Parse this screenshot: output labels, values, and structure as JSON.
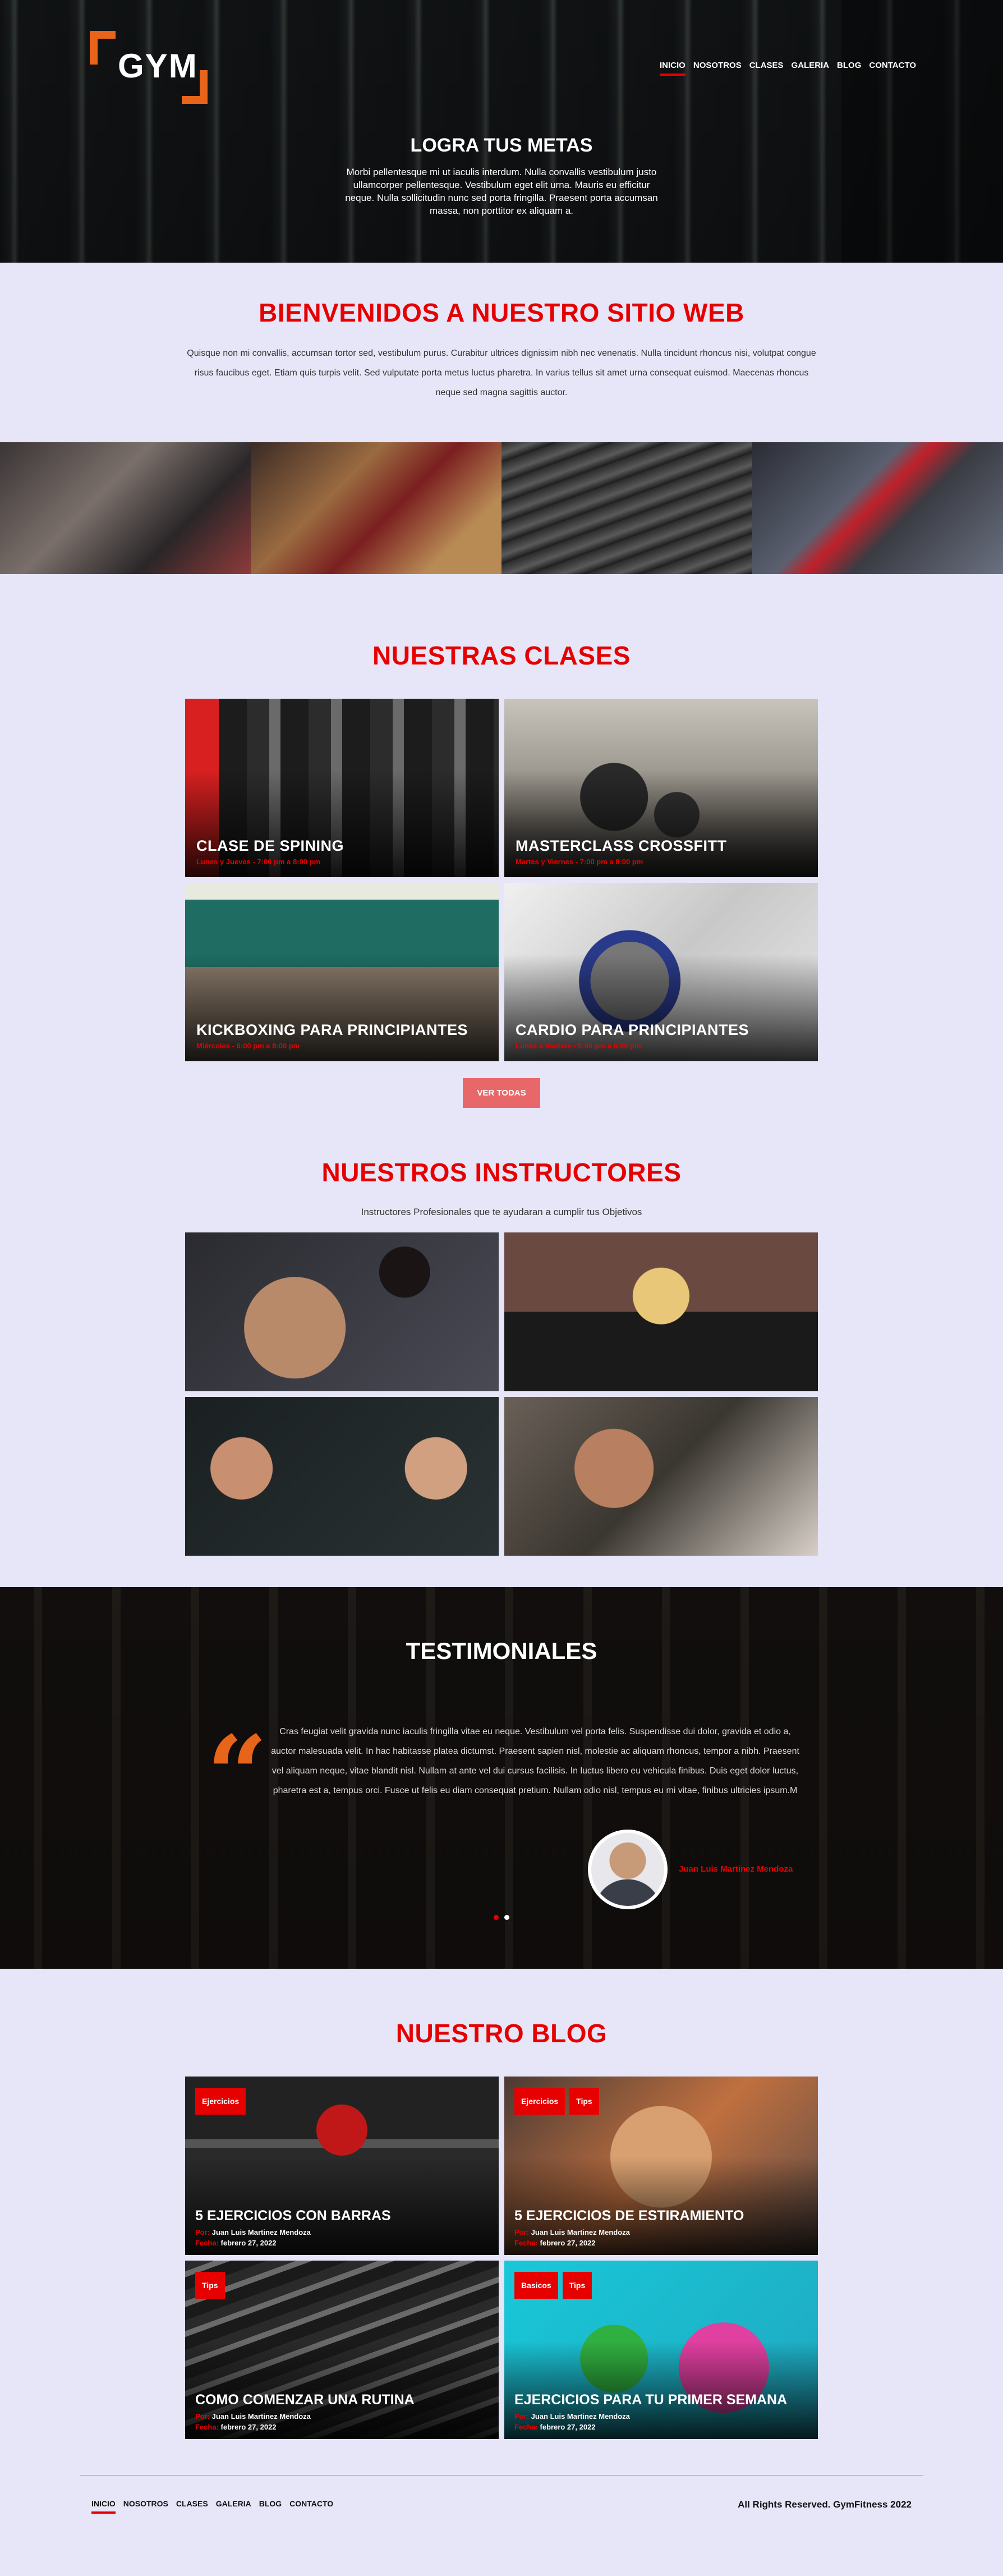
{
  "brand": {
    "logo_text": "GYM",
    "accent": "#e60000",
    "logo_color": "#e8641a"
  },
  "nav": [
    "INICIO",
    "NOSOTROS",
    "CLASES",
    "GALERIA",
    "BLOG",
    "CONTACTO"
  ],
  "hero": {
    "title": "LOGRA TUS METAS",
    "text": "Morbi pellentesque mi ut iaculis interdum. Nulla convallis vestibulum justo ullamcorper pellentesque. Vestibulum eget elit urna. Mauris eu efficitur neque. Nulla sollicitudin nunc sed porta fringilla. Praesent porta accumsan massa, non porttitor ex aliquam a."
  },
  "welcome": {
    "title": "BIENVENIDOS A NUESTRO SITIO WEB",
    "text": "Quisque non mi convallis, accumsan tortor sed, vestibulum purus. Curabitur ultrices dignissim nibh nec venenatis. Nulla tincidunt rhoncus nisi, volutpat congue risus faucibus eget. Etiam quis turpis velit. Sed vulputate porta metus luctus pharetra. In varius tellus sit amet urna consequat euismod. Maecenas rhoncus neque sed magna sagittis auctor."
  },
  "classes": {
    "title": "NUESTRAS CLASES",
    "items": [
      {
        "title": "CLASE DE SPINING",
        "schedule": "Lunes y Jueves - 7:00 pm a 8:00 pm"
      },
      {
        "title": "MASTERCLASS CROSSFITT",
        "schedule": "Martes y Viernes - 7:00 pm a 8:00 pm"
      },
      {
        "title": "KICKBOXING PARA PRINCIPIANTES",
        "schedule": "Miércoles - 6:00 pm a 8:00 pm"
      },
      {
        "title": "CARDIO PARA PRINCIPIANTES",
        "schedule": "Lunes a Viernes - 5:00 pm a 6:00 pm"
      }
    ],
    "button": "VER TODAS"
  },
  "instructors": {
    "title": "NUESTROS INSTRUCTORES",
    "subtitle": "Instructores Profesionales que te ayudaran a cumplir tus Objetivos"
  },
  "testimonials": {
    "title": "TESTIMONIALES",
    "quote": "Cras feugiat velit gravida nunc iaculis fringilla vitae eu neque. Vestibulum vel porta felis. Suspendisse dui dolor, gravida et odio a, auctor malesuada velit. In hac habitasse platea dictumst. Praesent sapien nisl, molestie ac aliquam rhoncus, tempor a nibh. Praesent vel aliquam neque, vitae blandit nisl. Nullam at ante vel dui cursus facilisis. In luctus libero eu vehicula finibus. Duis eget dolor luctus, pharetra est a, tempus orci. Fusce ut felis eu diam consequat pretium. Nullam odio nisl, tempus eu mi vitae, finibus ultricies ipsum.M",
    "author": "Juan Luis Martinez Mendoza"
  },
  "blog": {
    "title": "NUESTRO BLOG",
    "by_label": "Por:",
    "date_label": "Fecha:",
    "posts": [
      {
        "tags": [
          "Ejercicios"
        ],
        "title": "5 EJERCICIOS CON BARRAS",
        "author": "Juan Luis Martinez Mendoza",
        "date": "febrero 27, 2022"
      },
      {
        "tags": [
          "Ejercicios",
          "Tips"
        ],
        "title": "5 EJERCICIOS DE ESTIRAMIENTO",
        "author": "Juan Luis Martinez Mendoza",
        "date": "febrero 27, 2022"
      },
      {
        "tags": [
          "Tips"
        ],
        "title": "COMO COMENZAR UNA RUTINA",
        "author": "Juan Luis Martinez Mendoza",
        "date": "febrero 27, 2022"
      },
      {
        "tags": [
          "Basicos",
          "Tips"
        ],
        "title": "EJERCICIOS PARA TU PRIMER SEMANA",
        "author": "Juan Luis Martinez Mendoza",
        "date": "febrero 27, 2022"
      }
    ]
  },
  "footer": {
    "copyright": "All Rights Reserved. GymFitness 2022"
  }
}
